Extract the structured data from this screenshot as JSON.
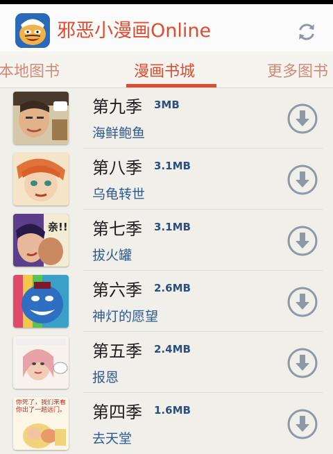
{
  "app": {
    "title": "邪恶小漫画Online",
    "icon": "cartoon-face-app-icon"
  },
  "toolbar": {
    "refresh_icon": "refresh-icon"
  },
  "tabs": [
    {
      "label": "本地图书"
    },
    {
      "label": "漫画书城"
    },
    {
      "label": "更多图书"
    }
  ],
  "active_tab": 1,
  "items": [
    {
      "season": "第九季",
      "size": "3MB",
      "subtitle": "海鲜鲍鱼",
      "thumb_color": "#c9b89a"
    },
    {
      "season": "第八季",
      "size": "3.1MB",
      "subtitle": "乌龟转世",
      "thumb_color": "#e0733a"
    },
    {
      "season": "第七季",
      "size": "3.1MB",
      "subtitle": "拔火罐",
      "thumb_color": "#5b3f8c"
    },
    {
      "season": "第六季",
      "size": "2.6MB",
      "subtitle": "神灯的愿望",
      "thumb_color": "#2f6fc1"
    },
    {
      "season": "第五季",
      "size": "2.4MB",
      "subtitle": "报恩",
      "thumb_color": "#e8a3a8"
    },
    {
      "season": "第四季",
      "size": "1.6MB",
      "subtitle": "去天堂",
      "thumb_color": "#f1d37a"
    }
  ],
  "thumb_texts": {
    "t7": "亲!!",
    "t4": "你死了，我们来看你出了一趟远门。"
  },
  "colors": {
    "accent": "#e04a2d",
    "link": "#2d5a8e",
    "icon": "#8e98a4"
  }
}
